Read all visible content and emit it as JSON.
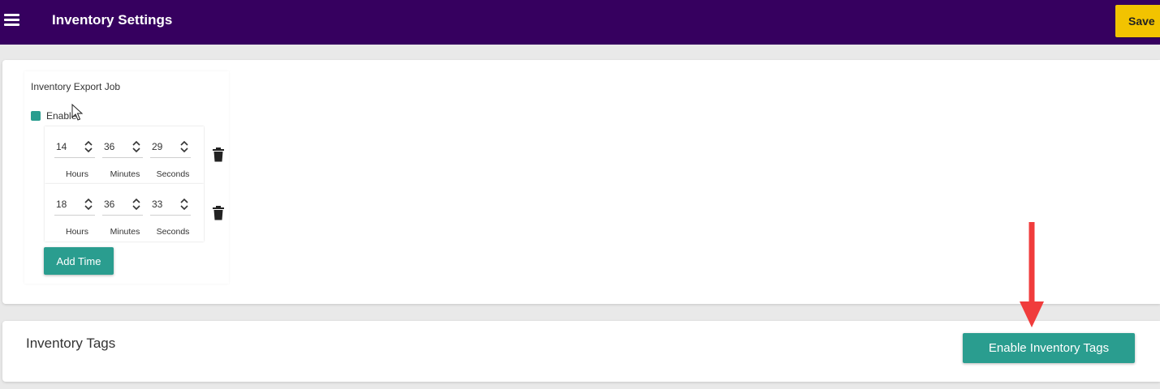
{
  "appbar": {
    "title": "Inventory Settings",
    "save_label": "Save",
    "color": "#36005f",
    "save_color": "#f2c300"
  },
  "export_job": {
    "title": "Inventory Export Job",
    "enable_label": "Enable",
    "enabled": true,
    "accent": "#2a9d8f",
    "times": [
      {
        "hours": "14",
        "minutes": "36",
        "seconds": "29"
      },
      {
        "hours": "18",
        "minutes": "36",
        "seconds": "33"
      }
    ],
    "labels": {
      "hours": "Hours",
      "minutes": "Minutes",
      "seconds": "Seconds"
    },
    "add_time_label": "Add Time"
  },
  "tags": {
    "title": "Inventory Tags",
    "enable_label": "Enable Inventory Tags"
  },
  "icons": {
    "menu": "menu-icon",
    "spinner": "chevron-up-down-icon",
    "delete": "trash-icon",
    "cursor": "mouse-pointer-icon",
    "annotation": "red-arrow-icon"
  },
  "annotation_color": "#f03c3c"
}
